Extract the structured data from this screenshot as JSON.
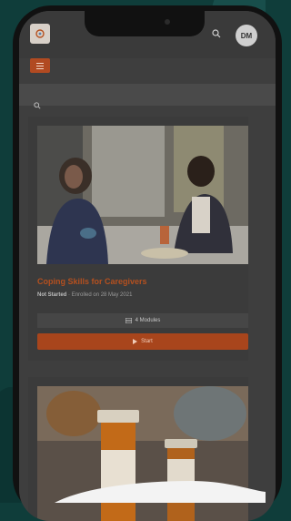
{
  "header": {
    "avatar_initials": "DM"
  },
  "courses": [
    {
      "title": "Coping Skills for Caregivers",
      "status": "Not Started",
      "enrolled": "Enrolled on 28 May 2021",
      "modules": "4 Modules",
      "action": "Start"
    }
  ],
  "colors": {
    "accent": "#b5501f",
    "background": "#0f3d3a"
  }
}
